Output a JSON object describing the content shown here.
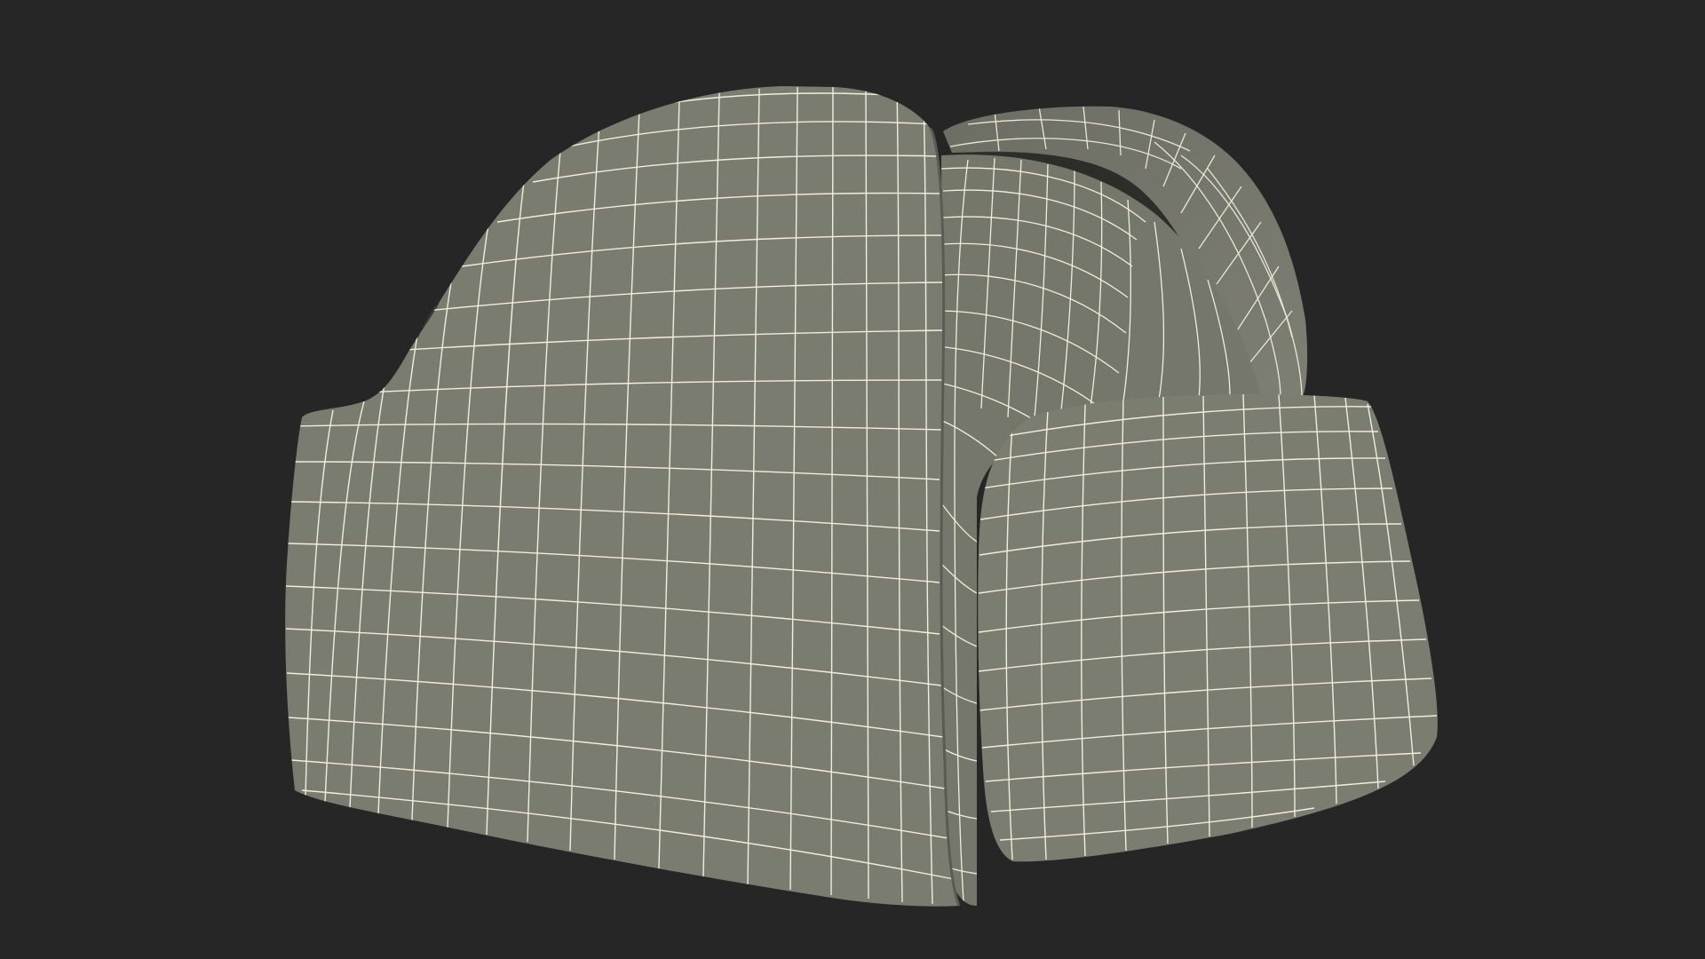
{
  "scene": {
    "subject": "ushanka-hat-wireframe-render",
    "colors": {
      "background": "#262626",
      "surface": "#7b7c70",
      "surface_dark": "#4a4b44",
      "surface_shadow": "#3a3b35",
      "wire": "#f0eedc"
    }
  }
}
